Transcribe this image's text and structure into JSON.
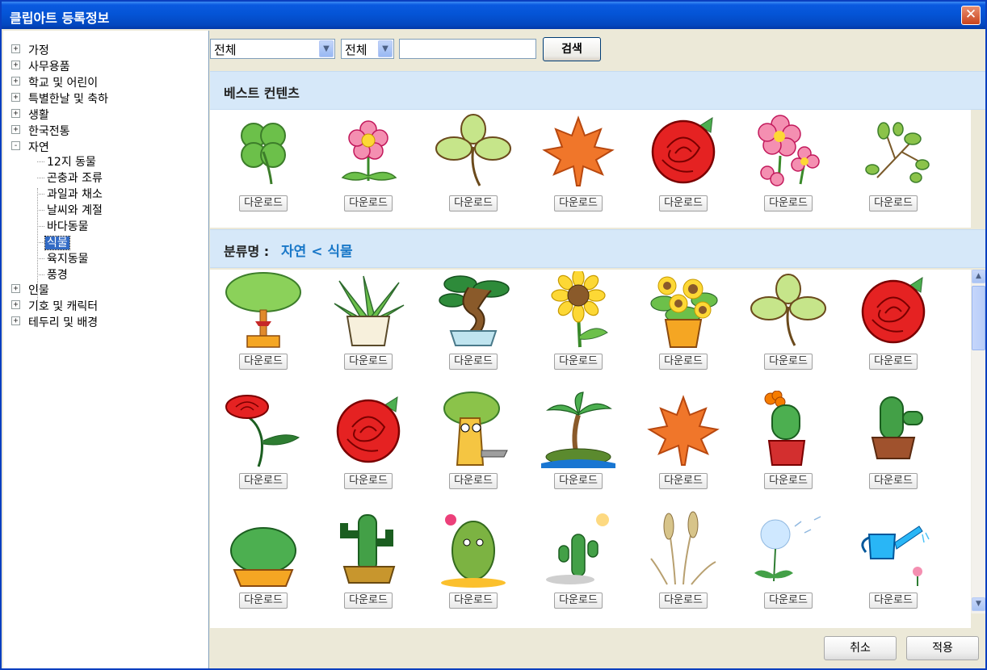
{
  "window": {
    "title": "클립아트 등록정보",
    "close_label": "✕"
  },
  "tree": {
    "nodes": [
      {
        "label": "가정",
        "toggle": "+"
      },
      {
        "label": "사무용품",
        "toggle": "+"
      },
      {
        "label": "학교 및 어린이",
        "toggle": "+"
      },
      {
        "label": "특별한날 및 축하",
        "toggle": "+"
      },
      {
        "label": "생활",
        "toggle": "+"
      },
      {
        "label": "한국전통",
        "toggle": "+"
      },
      {
        "label": "자연",
        "toggle": "-"
      },
      {
        "label": "인물",
        "toggle": "+"
      },
      {
        "label": "기호 및 캐릭터",
        "toggle": "+"
      },
      {
        "label": "테두리 및 배경",
        "toggle": "+"
      }
    ],
    "children": [
      {
        "label": "12지 동물"
      },
      {
        "label": "곤충과 조류"
      },
      {
        "label": "과일과 채소"
      },
      {
        "label": "날씨와 계절"
      },
      {
        "label": "바다동물"
      },
      {
        "label": "식물",
        "selected": true
      },
      {
        "label": "육지동물"
      },
      {
        "label": "풍경"
      }
    ]
  },
  "toolbar": {
    "filter1": "전체",
    "filter2": "전체",
    "search_value": "",
    "search_label": "검색"
  },
  "best": {
    "title": "베스트 컨텐츠",
    "items": [
      {
        "icon": "four-leaf-clover-icon"
      },
      {
        "icon": "pink-flower-icon"
      },
      {
        "icon": "clover-icon"
      },
      {
        "icon": "maple-leaf-icon"
      },
      {
        "icon": "red-rose-icon"
      },
      {
        "icon": "pink-flowers-icon"
      },
      {
        "icon": "green-sprig-icon"
      }
    ]
  },
  "category": {
    "label": "분류명 :",
    "path": "자연 < 식물"
  },
  "list": {
    "items": [
      {
        "icon": "potted-tree-icon"
      },
      {
        "icon": "snake-plant-icon"
      },
      {
        "icon": "bonsai-icon"
      },
      {
        "icon": "sunflower-icon"
      },
      {
        "icon": "potted-sunflowers-icon"
      },
      {
        "icon": "clover-icon"
      },
      {
        "icon": "red-rose-icon"
      },
      {
        "icon": "rose-stem-icon"
      },
      {
        "icon": "red-rose-icon"
      },
      {
        "icon": "tree-character-icon"
      },
      {
        "icon": "palm-island-icon"
      },
      {
        "icon": "maple-leaf-icon"
      },
      {
        "icon": "potted-cactus-flower-icon"
      },
      {
        "icon": "potted-cactus-icon"
      },
      {
        "icon": "round-cactus-icon"
      },
      {
        "icon": "tall-cactus-icon"
      },
      {
        "icon": "cactus-face-icon"
      },
      {
        "icon": "small-cactus-icon"
      },
      {
        "icon": "wheat-icon"
      },
      {
        "icon": "dandelion-icon"
      },
      {
        "icon": "watering-can-icon"
      }
    ]
  },
  "download_label": "다운로드",
  "footer": {
    "cancel_label": "취소",
    "apply_label": "적용"
  }
}
